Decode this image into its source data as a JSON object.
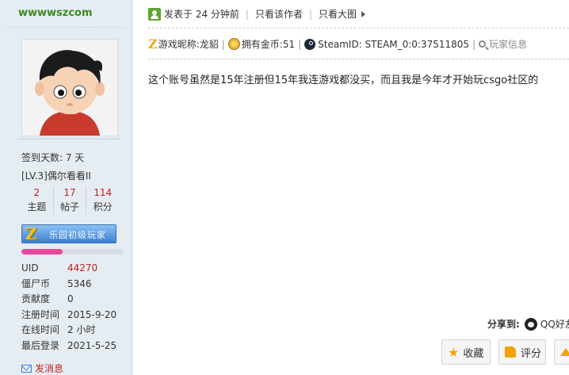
{
  "sidebar": {
    "username": "wwwwszcom",
    "signin": "签到天数: 7 天",
    "level": "[LV.3]偶尔看看II",
    "stats": [
      {
        "value": "2",
        "label": "主题"
      },
      {
        "value": "17",
        "label": "帖子"
      },
      {
        "value": "114",
        "label": "积分"
      }
    ],
    "badge": "乐园初级玩家",
    "level_progress_percent": 40,
    "info": [
      {
        "label": "UID",
        "value": "44270"
      },
      {
        "label": "僵尸币",
        "value": "5346"
      },
      {
        "label": "贡献度",
        "value": "0"
      },
      {
        "label": "注册时间",
        "value": "2015-9-20"
      },
      {
        "label": "在线时间",
        "value": "2 小时"
      },
      {
        "label": "最后登录",
        "value": "2021-5-25"
      }
    ],
    "pm": "发消息"
  },
  "post": {
    "posted": "发表于 24 分钟前",
    "only_author": "只看该作者",
    "only_images": "只看大图",
    "nickname": "游戏昵称:龙貂",
    "gold": "拥有金币:51",
    "steam": "SteamID: STEAM_0:0:37511805",
    "player_info": "玩家信息",
    "content": "这个账号虽然是15年注册但15年我连游戏都没买，而且我是今年才开始玩csgo社区的",
    "share_label": "分享到:",
    "share_qq": "QQ好友",
    "fav": "收藏",
    "rate": "评分"
  },
  "colors": {
    "accent": "#c32020",
    "username": "#3a8a22",
    "progress": "#e8479b"
  }
}
